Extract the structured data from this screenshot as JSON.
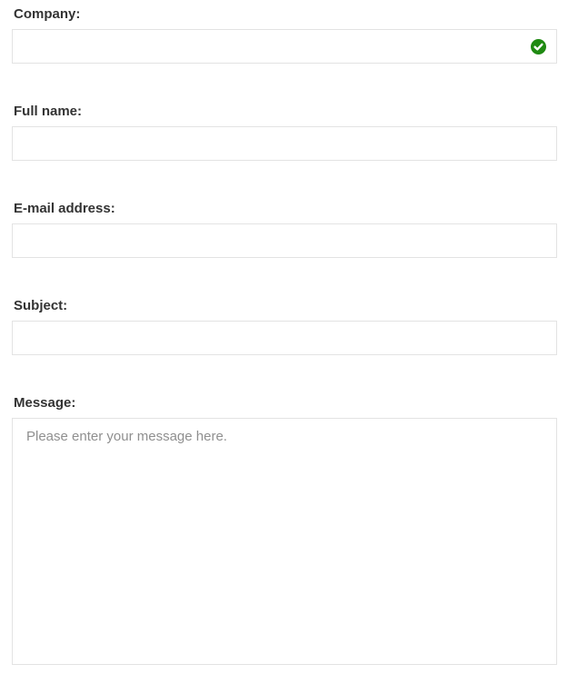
{
  "form": {
    "company": {
      "label": "Company:",
      "value": "",
      "status_icon": "check-circle-icon",
      "status_color": "#1f8a12"
    },
    "full_name": {
      "label": "Full name:",
      "value": ""
    },
    "email": {
      "label": "E-mail address:",
      "value": ""
    },
    "subject": {
      "label": "Subject:",
      "value": ""
    },
    "message": {
      "label": "Message:",
      "value": "",
      "placeholder": "Please enter your message here."
    }
  }
}
